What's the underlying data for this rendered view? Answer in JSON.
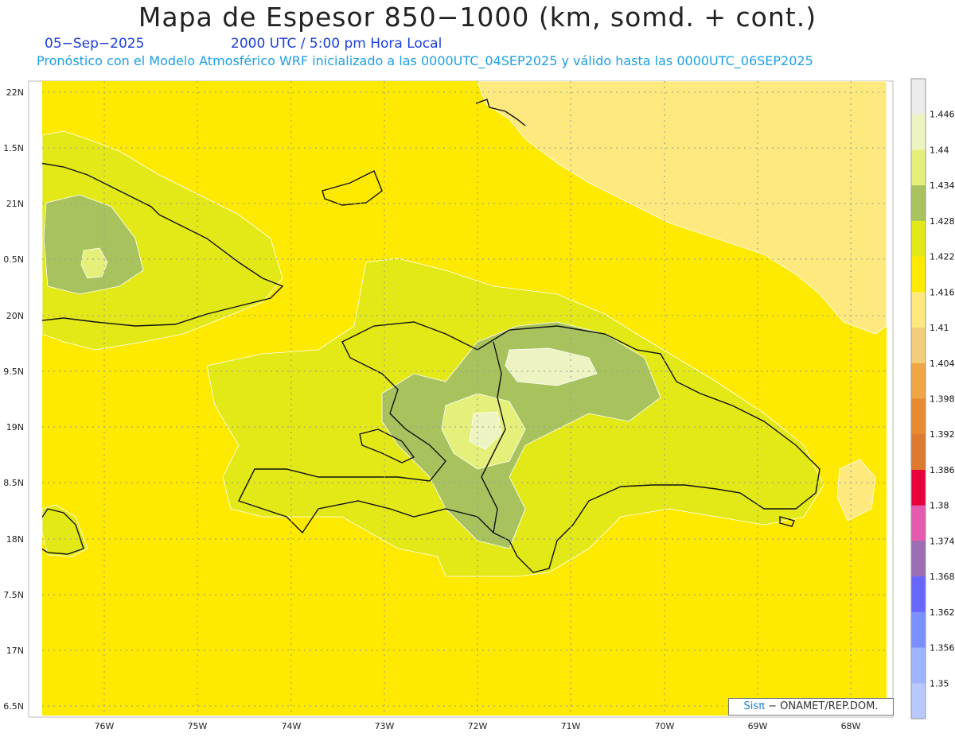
{
  "header": {
    "title": "Mapa de Espesor 850−1000 (km, somd. + cont.)",
    "date": "05−Sep−2025",
    "time": "2000 UTC / 5:00 pm Hora Local",
    "model_info": "Pronóstico con el Modelo Atmosférico WRF inicializado a las 0000UTC_04SEP2025 y válido hasta las  0000UTC_06SEP2025"
  },
  "map": {
    "lat_labels": [
      "22N",
      "1.5N",
      "21N",
      "0.5N",
      "20N",
      "9.5N",
      "19N",
      "8.5N",
      "18N",
      "7.5N",
      "17N",
      "6.5N"
    ],
    "lon_labels": [
      "76W",
      "75W",
      "74W",
      "73W",
      "72W",
      "71W",
      "70W",
      "69W",
      "68W"
    ],
    "field_colors": {
      "base": "#fdea00",
      "level_1422": "#e3e917",
      "level_1428": "#a8c35e",
      "level_1434": "#e5f07a",
      "level_1440": "#eef3c2",
      "level_1410": "#fde97e"
    }
  },
  "colorbar": {
    "labels": [
      "1.446",
      "1.44",
      "1.434",
      "1.428",
      "1.422",
      "1.416",
      "1.41",
      "1.404",
      "1.398",
      "1.392",
      "1.386",
      "1.38",
      "1.374",
      "1.368",
      "1.362",
      "1.356",
      "1.35"
    ],
    "colors": [
      "#ebebeb",
      "#eef3c2",
      "#e5f07a",
      "#a8c35e",
      "#e3e917",
      "#fdea00",
      "#fde97e",
      "#f4cd7a",
      "#efa644",
      "#e88a32",
      "#dd7a30",
      "#e8003b",
      "#e45aae",
      "#9c6eb4",
      "#6766ff",
      "#7b90ff",
      "#9fb4ff",
      "#b9c8ff"
    ]
  },
  "credit": {
    "brand": "Sisπ",
    "text": " − ONAMET/REP.DOM."
  }
}
